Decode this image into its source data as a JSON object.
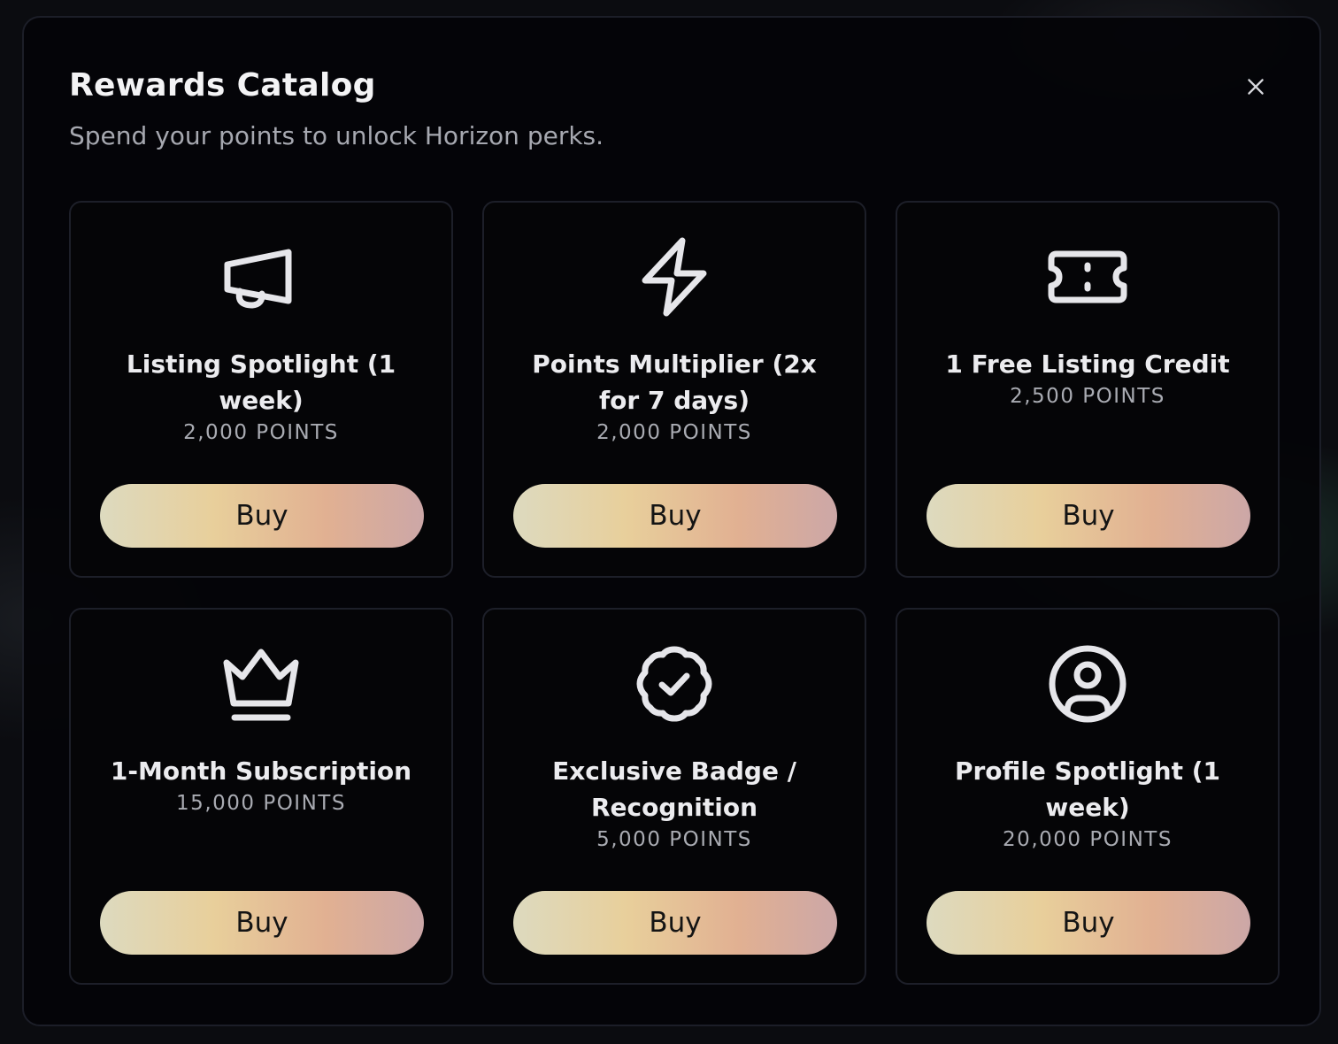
{
  "modal": {
    "title": "Rewards Catalog",
    "subtitle": "Spend your points to unlock Horizon perks.",
    "close_icon": "close-icon"
  },
  "rewards": [
    {
      "icon": "megaphone-icon",
      "title": "Listing Spotlight (1 week)",
      "points": "2,000 POINTS",
      "button": "Buy"
    },
    {
      "icon": "lightning-icon",
      "title": "Points Multiplier (2x for 7 days)",
      "points": "2,000 POINTS",
      "button": "Buy"
    },
    {
      "icon": "ticket-icon",
      "title": "1 Free Listing Credit",
      "points": "2,500 POINTS",
      "button": "Buy"
    },
    {
      "icon": "crown-icon",
      "title": "1-Month Subscription",
      "points": "15,000 POINTS",
      "button": "Buy"
    },
    {
      "icon": "badge-check-icon",
      "title": "Exclusive Badge / Recognition",
      "points": "5,000 POINTS",
      "button": "Buy"
    },
    {
      "icon": "user-circle-icon",
      "title": "Profile Spotlight (1 week)",
      "points": "20,000 POINTS",
      "button": "Buy"
    }
  ],
  "colors": {
    "button_gradient": [
      "#dddabf",
      "#e8cf9b",
      "#e1b092",
      "#cca7a7"
    ],
    "card_border": "#1d1f29",
    "text_primary": "#ececef",
    "text_secondary": "#a9abb2"
  }
}
